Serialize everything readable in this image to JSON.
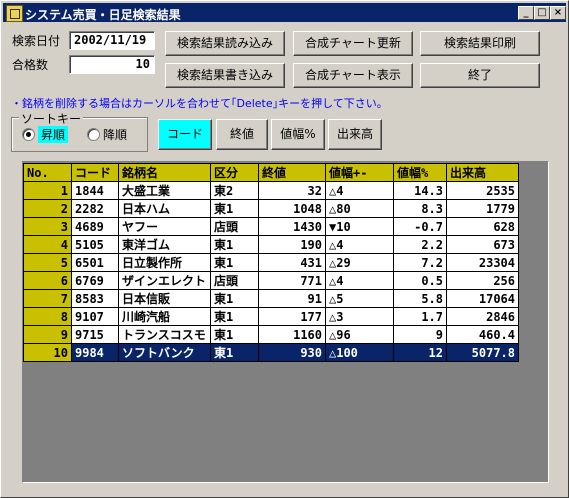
{
  "window": {
    "title": "システム売買・日足検索結果",
    "controls": [
      "_",
      "□",
      "×"
    ]
  },
  "form": {
    "date_label": "検索日付",
    "date_value": "2002/11/19",
    "count_label": "合格数",
    "count_value": "10"
  },
  "buttons": {
    "load": "検索結果読み込み",
    "save": "検索結果書き込み",
    "chart_update": "合成チャート更新",
    "chart_show": "合成チャート表示",
    "print": "検索結果印刷",
    "exit": "終了"
  },
  "note": "・銘柄を削除する場合はカーソルを合わせて｢Delete｣キーを押して下さい。",
  "sort": {
    "title": "ソートキー",
    "asc": "昇順",
    "desc": "降順",
    "keys": [
      "コード",
      "終値",
      "値幅%",
      "出来高"
    ],
    "active_key": "コード",
    "active_key_color": "#00ffff"
  },
  "grid": {
    "columns": [
      "No.",
      "コード",
      "銘柄名",
      "区分",
      "終値",
      "値幅+-",
      "値幅%",
      "出来高"
    ],
    "rows": [
      [
        "1",
        "1844",
        "大盛工業",
        "東2",
        "32",
        "△4",
        "14.3",
        "2535"
      ],
      [
        "2",
        "2282",
        "日本ハム",
        "東1",
        "1048",
        "△80",
        "8.3",
        "1779"
      ],
      [
        "3",
        "4689",
        "ヤフー",
        "店頭",
        "1430",
        "▼10",
        "-0.7",
        "628"
      ],
      [
        "4",
        "5105",
        "東洋ゴム",
        "東1",
        "190",
        "△4",
        "2.2",
        "673"
      ],
      [
        "5",
        "6501",
        "日立製作所",
        "東1",
        "431",
        "△29",
        "7.2",
        "23304"
      ],
      [
        "6",
        "6769",
        "ザインエレクト",
        "店頭",
        "771",
        "△4",
        "0.5",
        "256"
      ],
      [
        "7",
        "8583",
        "日本信販",
        "東1",
        "91",
        "△5",
        "5.8",
        "17064"
      ],
      [
        "8",
        "9107",
        "川崎汽船",
        "東1",
        "177",
        "△3",
        "1.7",
        "2846"
      ],
      [
        "9",
        "9715",
        "トランスコスモ",
        "東1",
        "1160",
        "△96",
        "9",
        "460.4"
      ],
      [
        "10",
        "9984",
        "ソフトバンク",
        "東1",
        "930",
        "△100",
        "12",
        "5077.8"
      ]
    ],
    "selected_row": "10",
    "header_color": "#c8c000",
    "selected_color": "#0a246a"
  }
}
